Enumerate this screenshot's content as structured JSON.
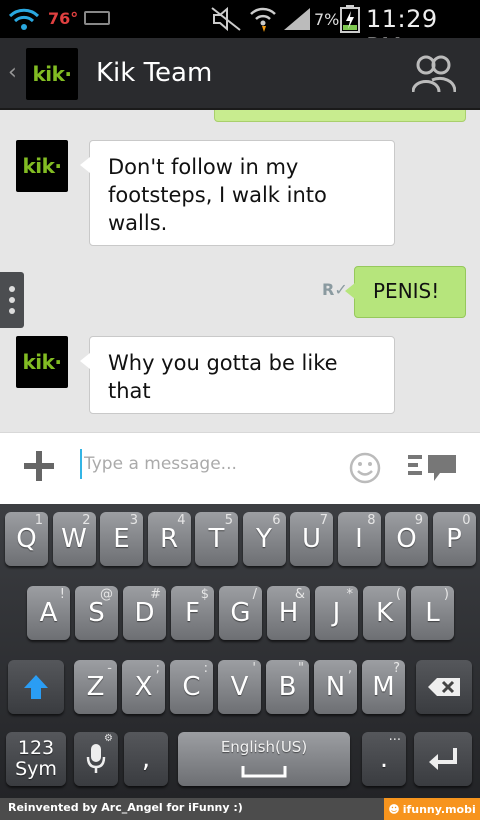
{
  "status_bar": {
    "temperature": "76°",
    "battery_percent": "7%",
    "time": "11:29 PM",
    "icons": [
      "wifi-icon",
      "keyboard-icon",
      "mute-icon",
      "wifi-signal-icon",
      "cell-signal-icon",
      "battery-charging-icon"
    ]
  },
  "header": {
    "back_icon": "‹",
    "logo_text": "kik·",
    "title": "Kik Team",
    "people_icon": "people-icon"
  },
  "chat": {
    "messages": [
      {
        "from": "Kik Team",
        "avatar_text": "kik·",
        "text": "Don't follow in my footsteps, I walk into walls."
      },
      {
        "from": "me",
        "text": "PENIS!",
        "receipt": "R"
      },
      {
        "from": "Kik Team",
        "avatar_text": "kik·",
        "text": "Why you gotta be like that"
      }
    ]
  },
  "input": {
    "placeholder": "Type a message..."
  },
  "keyboard": {
    "row1": [
      {
        "k": "Q",
        "s": "1"
      },
      {
        "k": "W",
        "s": "2"
      },
      {
        "k": "E",
        "s": "3"
      },
      {
        "k": "R",
        "s": "4"
      },
      {
        "k": "T",
        "s": "5"
      },
      {
        "k": "Y",
        "s": "6"
      },
      {
        "k": "U",
        "s": "7"
      },
      {
        "k": "I",
        "s": "8"
      },
      {
        "k": "O",
        "s": "9"
      },
      {
        "k": "P",
        "s": "0"
      }
    ],
    "row2": [
      {
        "k": "A",
        "s": "!"
      },
      {
        "k": "S",
        "s": "@"
      },
      {
        "k": "D",
        "s": "#"
      },
      {
        "k": "F",
        "s": "$"
      },
      {
        "k": "G",
        "s": "/"
      },
      {
        "k": "H",
        "s": "&"
      },
      {
        "k": "J",
        "s": "*"
      },
      {
        "k": "K",
        "s": "("
      },
      {
        "k": "L",
        "s": ")"
      }
    ],
    "row3": [
      {
        "k": "Z",
        "s": "-"
      },
      {
        "k": "X",
        "s": ";"
      },
      {
        "k": "C",
        "s": ":"
      },
      {
        "k": "V",
        "s": "'"
      },
      {
        "k": "B",
        "s": "\""
      },
      {
        "k": "N",
        "s": ","
      },
      {
        "k": "M",
        "s": "?"
      }
    ],
    "sym_label": "123\nSym",
    "comma": ",",
    "space_label": "English(US)",
    "period": ".",
    "period_sec": "···"
  },
  "footer": {
    "credit": "Reinvented by Arc_Angel for iFunny :)",
    "brand": "ifunny.mobi"
  },
  "colors": {
    "kik_green": "#82bc23",
    "bubble_out": "#b6e57c",
    "accent_blue": "#33b5e5",
    "ifunny_orange": "#f7941d"
  }
}
